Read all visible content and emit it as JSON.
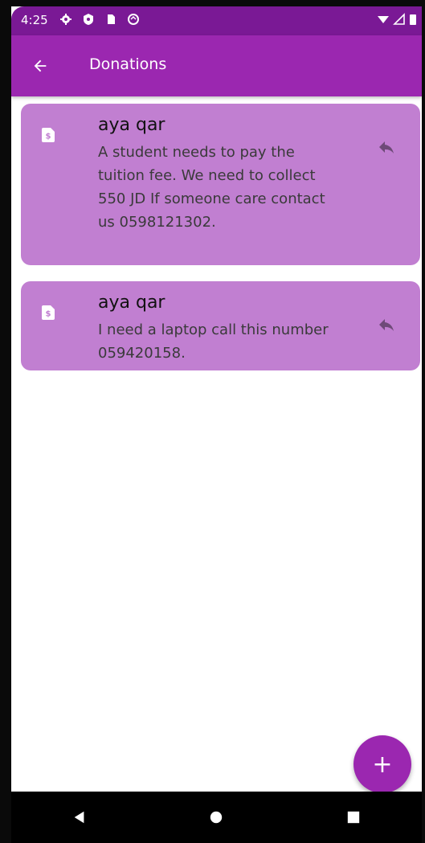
{
  "status_bar": {
    "time": "4:25"
  },
  "app_bar": {
    "title": "Donations"
  },
  "posts": [
    {
      "name": "aya qar",
      "text": "A student needs to pay the tuition fee. We need to collect 550 JD If someone care contact us 0598121302."
    },
    {
      "name": "aya qar",
      "text": "I need a laptop call this number 059420158."
    }
  ],
  "fab": {
    "label": "+"
  },
  "colors": {
    "status_bar": "#7a1995",
    "app_bar": "#9b27b0",
    "card": "#c17fd1",
    "fab": "#9b27b0"
  }
}
